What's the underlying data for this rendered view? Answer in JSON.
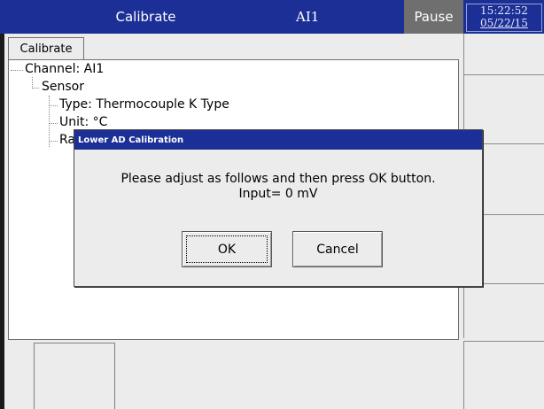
{
  "header": {
    "screen_title": "Calibrate",
    "channel": "AI1",
    "status": "Pause",
    "time": "15:22:52",
    "date": "05/22/15"
  },
  "panel": {
    "tab_label": "Calibrate",
    "tree": {
      "channel": "Channel: AI1",
      "sensor": "Sensor",
      "type": "Type: Thermocouple K Type",
      "unit": "Unit: °C",
      "range_partial": "Ra"
    }
  },
  "dialog": {
    "title": "Lower AD Calibration",
    "message_line1": "Please adjust as follows and then press OK button.",
    "message_line2": "Input= 0 mV",
    "ok_label": "OK",
    "cancel_label": "Cancel"
  },
  "colors": {
    "title_bar": "#1c2f96",
    "status_box": "#6f6f6f",
    "panel_bg": "#ececec"
  }
}
